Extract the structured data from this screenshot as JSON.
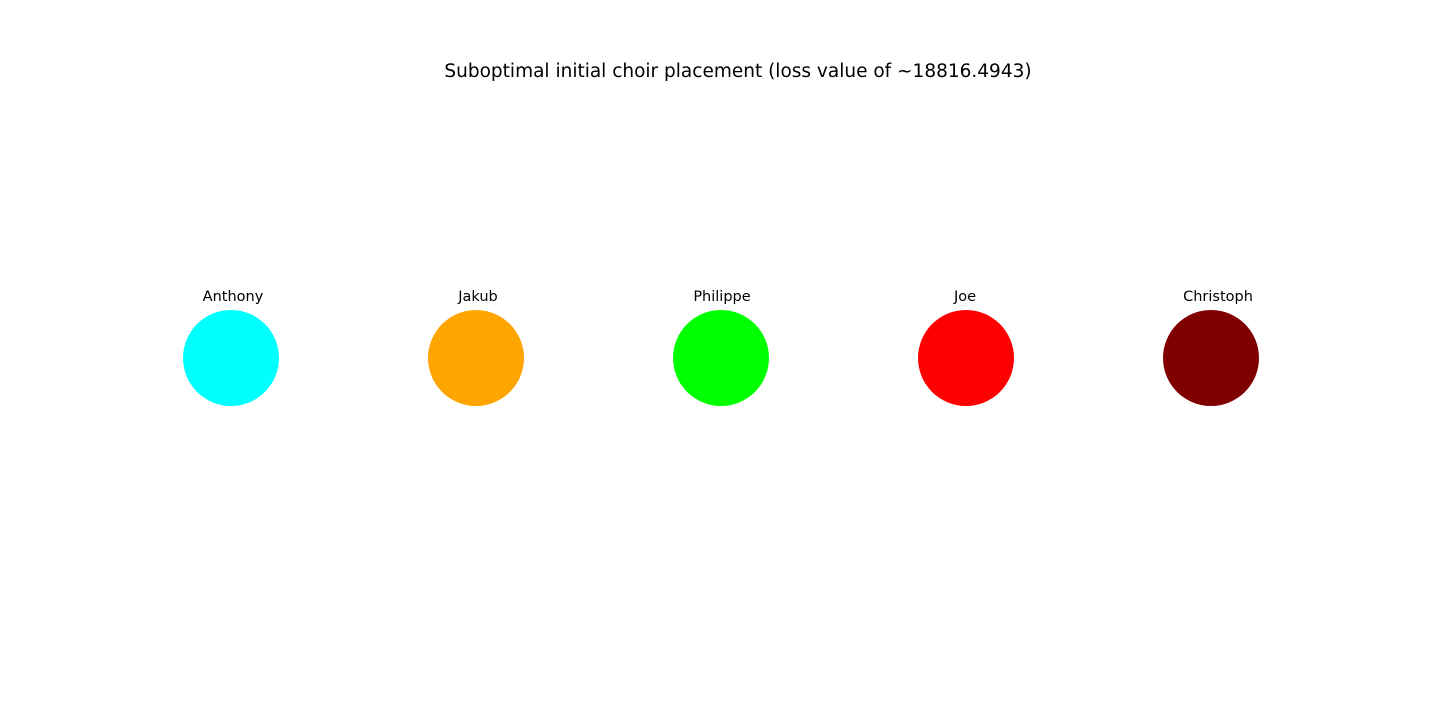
{
  "chart_data": {
    "type": "scatter",
    "title": "Suboptimal initial choir placement (loss value of ~18816.4943)",
    "xlabel": "",
    "ylabel": "",
    "axes_visible": false,
    "grid": false,
    "points": [
      {
        "label": "Anthony",
        "x": 1,
        "y": 0,
        "color": "#00ffff"
      },
      {
        "label": "Jakub",
        "x": 2,
        "y": 0,
        "color": "#ffa500"
      },
      {
        "label": "Philippe",
        "x": 3,
        "y": 0,
        "color": "#00ff00"
      },
      {
        "label": "Joe",
        "x": 4,
        "y": 0,
        "color": "#ff0000"
      },
      {
        "label": "Christoph",
        "x": 5,
        "y": 0,
        "color": "#800000"
      }
    ]
  }
}
